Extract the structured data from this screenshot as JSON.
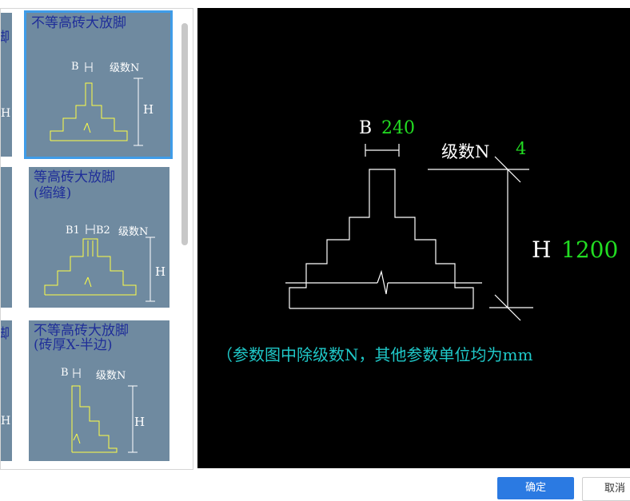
{
  "thumbnails": [
    {
      "title_lines": [
        "不等高砖大放脚"
      ],
      "b_label": "B",
      "n_label": "级数N",
      "h_label": "H"
    },
    {
      "title_lines": [
        "等高砖大放脚",
        "(缩缝)"
      ],
      "b_label": "B1",
      "b2_label": "B2",
      "n_label": "级数N",
      "h_label": "H"
    },
    {
      "title_lines": [
        "不等高砖大放脚",
        "(砖厚X-半边)"
      ],
      "b_label": "B",
      "n_label": "级数N",
      "h_label": "H"
    }
  ],
  "left_col_partial": [
    "脚",
    "H",
    "(",
    "脚",
    "H"
  ],
  "preview": {
    "b_label": "B",
    "b_value": "240",
    "n_label": "级数N",
    "n_value": "4",
    "h_label": "H",
    "h_value": "1200",
    "note": "（参数图中除级数N，其他参数单位均为mm"
  },
  "buttons": {
    "ok": "确定",
    "cancel": "取消"
  },
  "colors": {
    "thumb_bg": "#6f8aa0",
    "title": "#1f2e99",
    "param_value": "#22dd22",
    "note": "#1fc8c8",
    "selected": "#3f9ce8",
    "primary_button": "#2b7ae2"
  }
}
